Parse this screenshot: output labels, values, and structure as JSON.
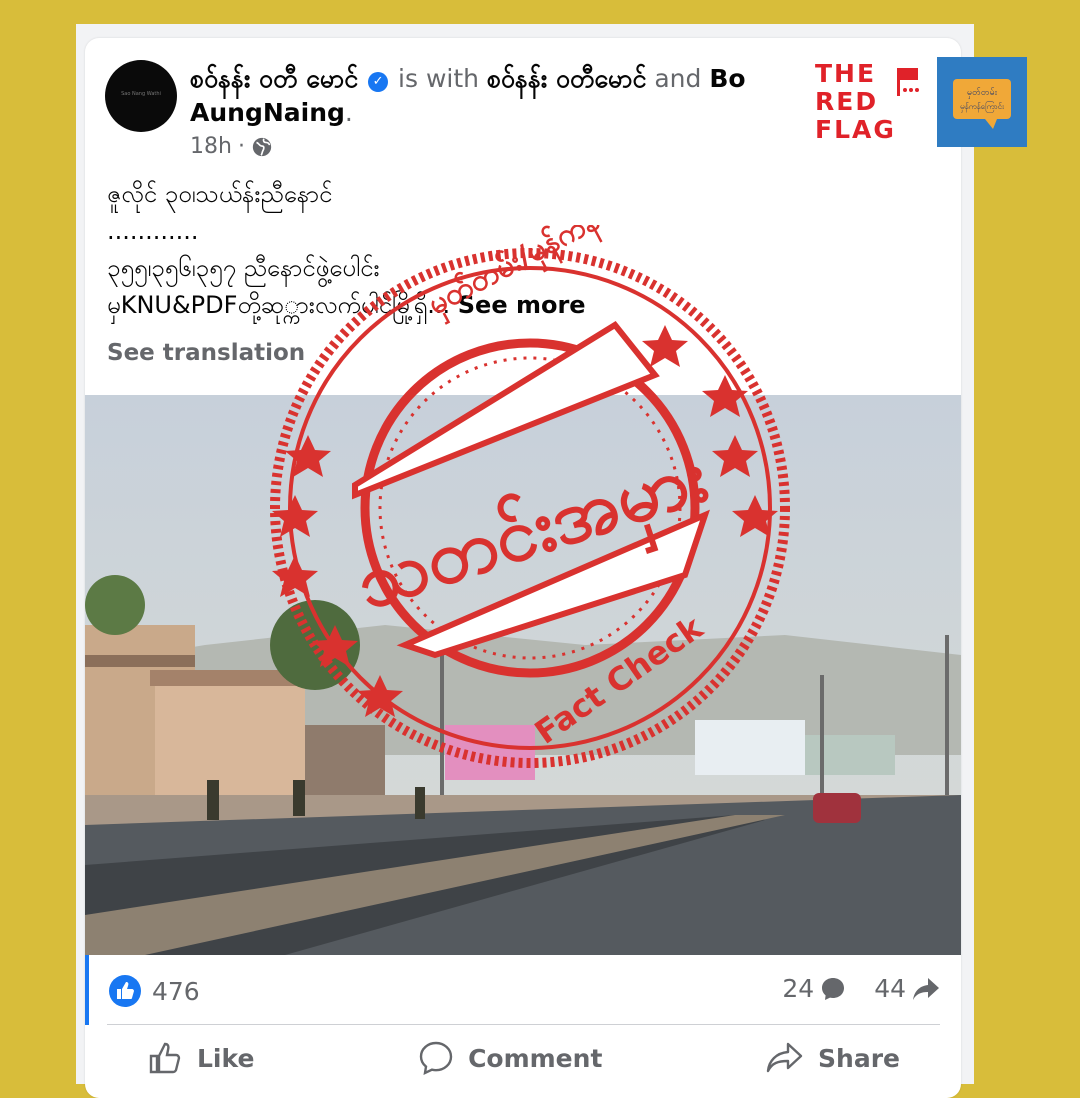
{
  "post": {
    "author": "စဝ်နန်း ဝတီ မောင်",
    "with_text": "is with",
    "tagged_1": "စဝ်နန်း ဝတီမောင်",
    "and_text": "and",
    "tagged_2": "Bo AungNaing",
    "period": ".",
    "time": "18h",
    "separator": "·",
    "line1": "ဇူလိုင် ၃၀၊သယ်န်းညီနောင်",
    "line2": "............",
    "line3": "၃၅၅၊၃၅၆၊၃၅၇ ညီနောင်ဖွဲ့ပေါင်း",
    "line4": "မှKNU&PDFတို့ဆု္ကားလက်ပါင်မြို့ရှိ...",
    "see_more": "See more",
    "see_translation": "See translation",
    "avatar_text": "Sao Nang Wathi"
  },
  "stamp": {
    "main_text": "သတင်းအမှား",
    "top_text": "မှတ်တမ်း/မှန်ကန်",
    "bottom_text": "Fact Check",
    "color": "#d9322f"
  },
  "brand": {
    "red_flag_lines": [
      "THE",
      "RED",
      "FLAG"
    ],
    "badge_line1": "မှတ်တမ်း",
    "badge_line2": "မှန်ကန်ကြောင်း"
  },
  "engagement": {
    "likes": "476",
    "comments": "24",
    "shares": "44"
  },
  "actions": {
    "like": "Like",
    "comment": "Comment",
    "share": "Share"
  },
  "colors": {
    "background": "#d8bd3a",
    "facebook_blue": "#1877f2",
    "red_flag": "#e02229"
  }
}
